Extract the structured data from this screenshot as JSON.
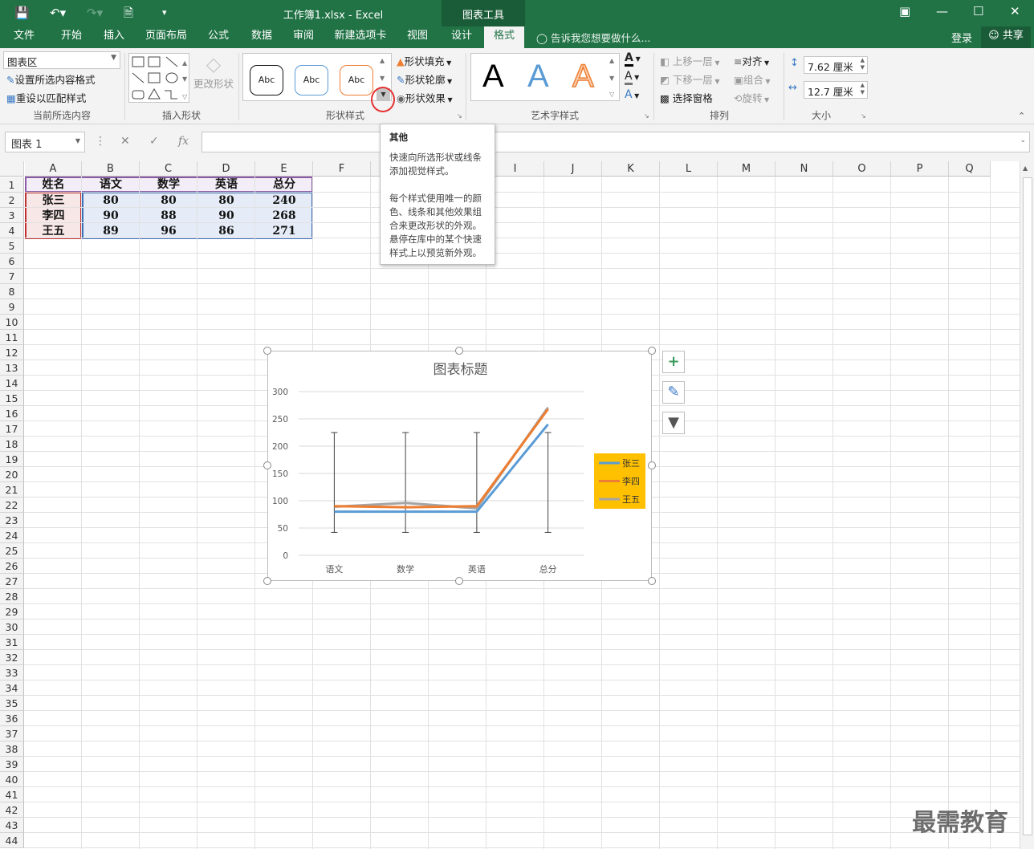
{
  "titlebar": {
    "file_title": "工作簿1.xlsx - Excel",
    "context_title": "图表工具"
  },
  "tabs": [
    "文件",
    "开始",
    "插入",
    "页面布局",
    "公式",
    "数据",
    "审阅",
    "新建选项卡",
    "视图",
    "设计",
    "格式"
  ],
  "active_tab": "格式",
  "tell_me": "告诉我您想要做什么...",
  "account": {
    "login": "登录",
    "share": "共享"
  },
  "ribbon": {
    "current_selection": {
      "combo_value": "图表区",
      "format_selection": "设置所选内容格式",
      "reset_style": "重设以匹配样式",
      "label": "当前所选内容"
    },
    "insert_shapes": {
      "change_shape": "更改形状",
      "label": "插入形状"
    },
    "shape_styles": {
      "style_buttons": [
        "Abc",
        "Abc",
        "Abc"
      ],
      "fill": "形状填充",
      "outline": "形状轮廓",
      "effects": "形状效果",
      "label": "形状样式"
    },
    "wordart": {
      "letters": [
        "A",
        "A",
        "A"
      ],
      "label": "艺术字样式"
    },
    "arrange": {
      "bring_forward": "上移一层",
      "send_backward": "下移一层",
      "selection_pane": "选择窗格",
      "align": "对齐",
      "group": "组合",
      "rotate": "旋转",
      "label": "排列"
    },
    "size": {
      "height": "7.62 厘米",
      "width": "12.7 厘米",
      "label": "大小"
    }
  },
  "formula_bar": {
    "name_box": "图表 1",
    "fx": "fx",
    "content": ""
  },
  "columns": [
    "A",
    "B",
    "C",
    "D",
    "E",
    "F",
    "G",
    "H",
    "I",
    "J",
    "K",
    "L",
    "M",
    "N",
    "O",
    "P",
    "Q"
  ],
  "rows": [
    "1",
    "2",
    "3",
    "4",
    "5",
    "6",
    "7",
    "8",
    "9",
    "10",
    "11",
    "12",
    "13",
    "14",
    "15",
    "16",
    "17",
    "18",
    "19",
    "20",
    "21",
    "22",
    "23",
    "24",
    "25",
    "26",
    "27",
    "28",
    "29",
    "30",
    "31",
    "32",
    "33",
    "34",
    "35",
    "36",
    "37",
    "38",
    "39",
    "40",
    "41",
    "42",
    "43",
    "44"
  ],
  "table": {
    "headers": [
      "姓名",
      "语文",
      "数学",
      "英语",
      "总分"
    ],
    "rows": [
      [
        "张三",
        "80",
        "80",
        "80",
        "240"
      ],
      [
        "李四",
        "90",
        "88",
        "90",
        "268"
      ],
      [
        "王五",
        "89",
        "96",
        "86",
        "271"
      ]
    ]
  },
  "tooltip": {
    "title": "其他",
    "line1": "快速向所选形状或线条添加视觉样式。",
    "line2": "每个样式使用唯一的颜色、线条和其他效果组合来更改形状的外观。悬停在库中的某个快速样式上以预览新外观。"
  },
  "chart_data": {
    "type": "line",
    "title": "图表标题",
    "categories": [
      "语文",
      "数学",
      "英语",
      "总分"
    ],
    "series": [
      {
        "name": "张三",
        "values": [
          80,
          80,
          80,
          240
        ],
        "color": "#5b9bd5"
      },
      {
        "name": "李四",
        "values": [
          90,
          88,
          90,
          268
        ],
        "color": "#ed7d31"
      },
      {
        "name": "王五",
        "values": [
          89,
          96,
          86,
          271
        ],
        "color": "#a5a5a5"
      }
    ],
    "ylim": [
      0,
      300
    ],
    "yticks": [
      "0",
      "50",
      "100",
      "150",
      "200",
      "250",
      "300"
    ],
    "error_bars": {
      "low": 42,
      "high": 225
    },
    "legend_position": "right",
    "legend_bg": "#ffc000",
    "grid": true
  },
  "watermark": "最需教育"
}
